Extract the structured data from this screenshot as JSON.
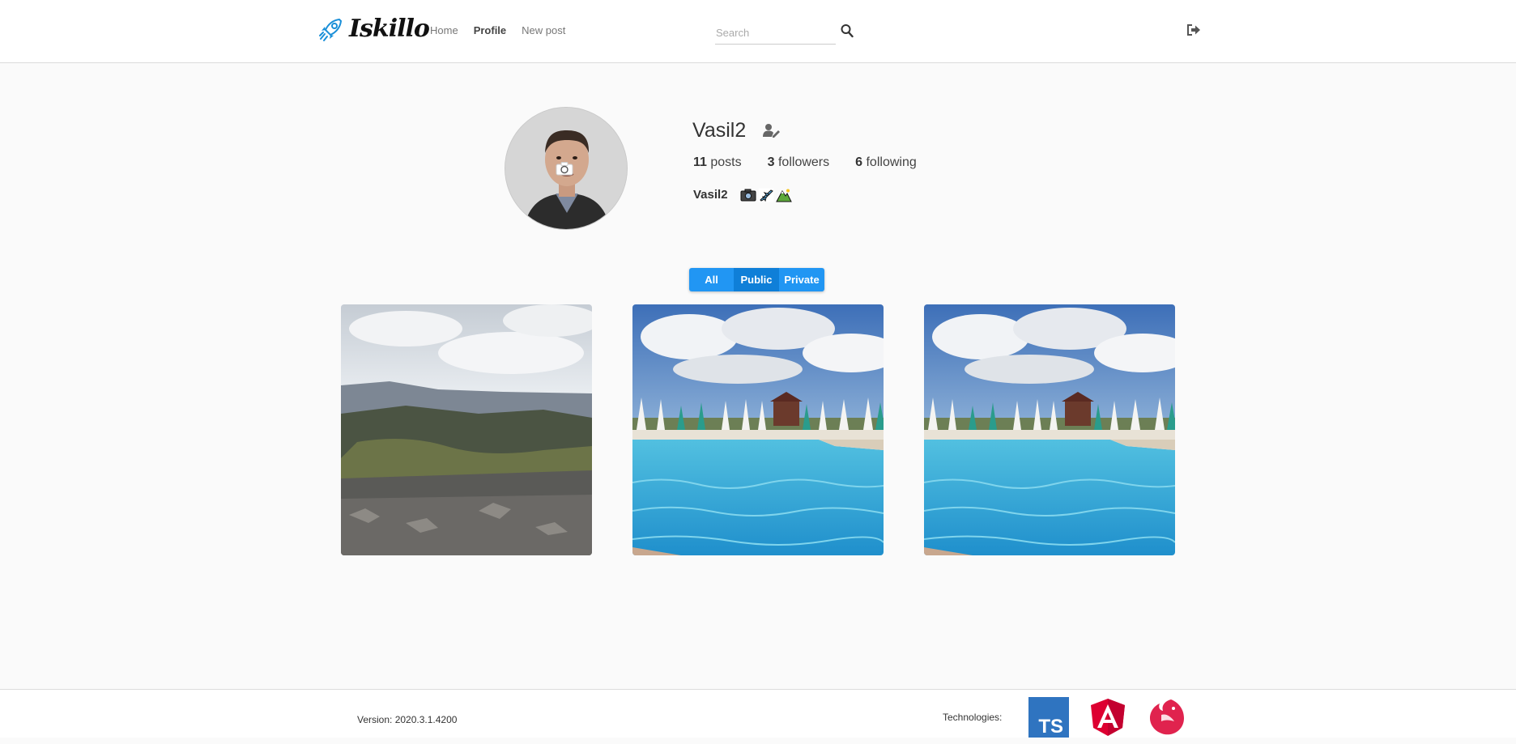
{
  "app": {
    "logo_text": "Iskillo"
  },
  "nav": {
    "home": "Home",
    "profile": "Profile",
    "new_post": "New post"
  },
  "search": {
    "placeholder": "Search",
    "value": ""
  },
  "profile": {
    "username": "Vasil2",
    "posts_count": "11",
    "posts_label": "posts",
    "followers_count": "3",
    "followers_label": "followers",
    "following_count": "6",
    "following_label": "following",
    "bio_name": "Vasil2",
    "bio_icons": [
      "camera-emoji",
      "airplane-emoji",
      "mountain-emoji"
    ]
  },
  "filters": {
    "all": "All",
    "public": "Public",
    "private": "Private",
    "selected": "Public"
  },
  "posts": [
    {
      "subject": "mountain-landscape"
    },
    {
      "subject": "swimming-pool"
    },
    {
      "subject": "swimming-pool"
    }
  ],
  "footer": {
    "version": "Version: 2020.3.1.4200",
    "technologies_label": "Technologies:",
    "technologies": [
      "TS",
      "Angular",
      "NestJS"
    ]
  },
  "colors": {
    "accent": "#2196f3",
    "accent_dark": "#0f7fd8"
  }
}
